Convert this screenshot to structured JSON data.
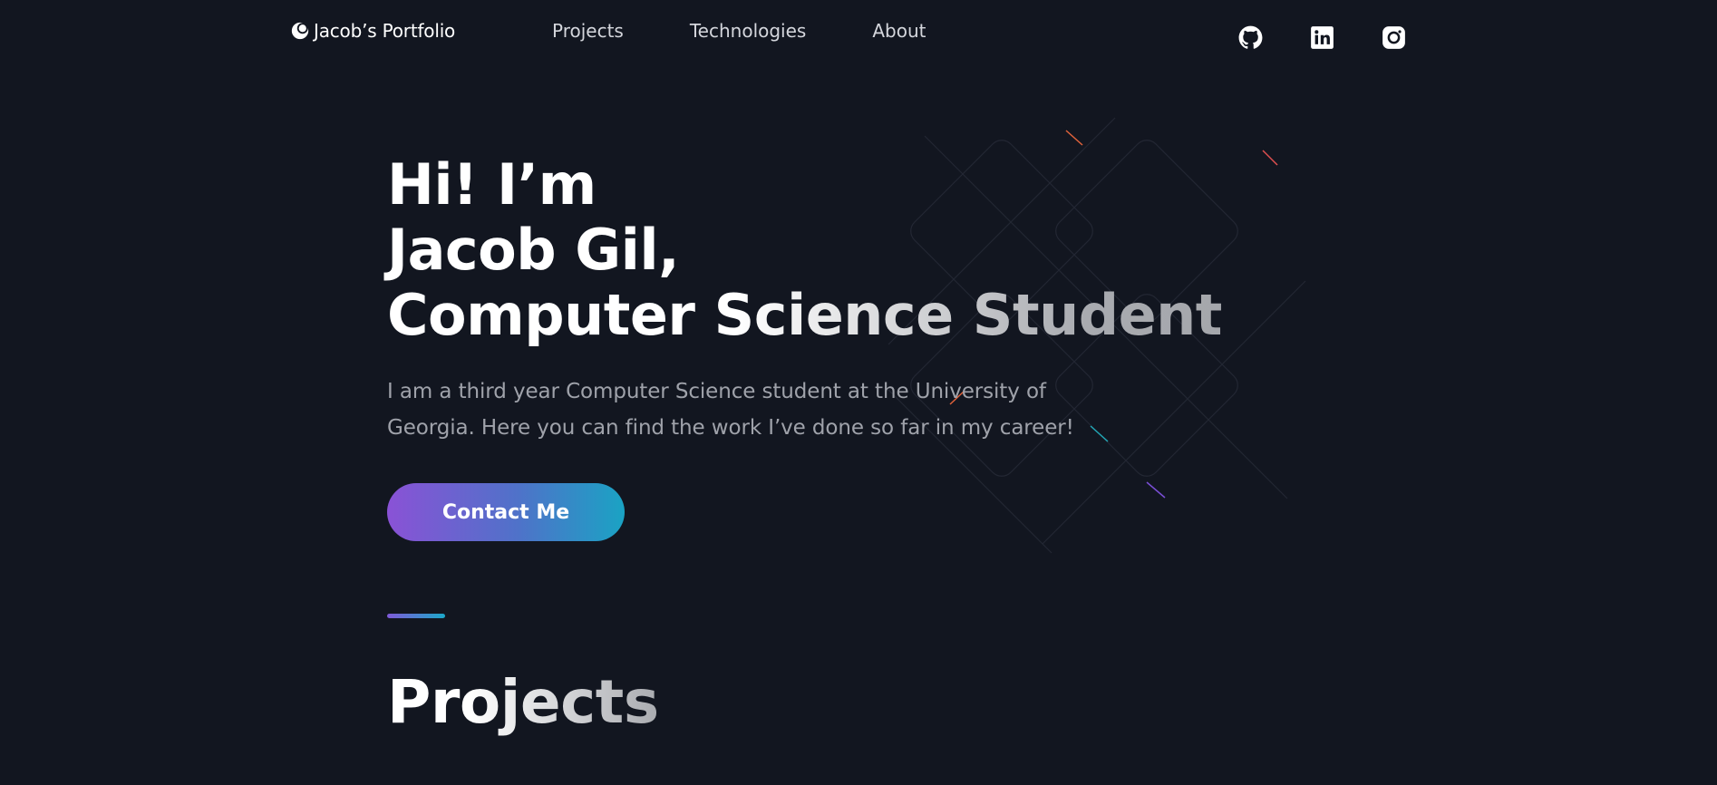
{
  "header": {
    "brand": "Jacob’s Portfolio",
    "nav": [
      {
        "label": "Projects"
      },
      {
        "label": "Technologies"
      },
      {
        "label": "About"
      }
    ],
    "socials": [
      {
        "icon": "github-icon"
      },
      {
        "icon": "linkedin-icon"
      },
      {
        "icon": "instagram-icon"
      }
    ]
  },
  "hero": {
    "line1": "Hi! I’m",
    "line2": "Jacob Gil,",
    "line3": "Computer Science Student",
    "description": "I am a third year Computer Science student at the University of Georgia. Here you can find the work I’ve done so far in my career!",
    "cta_label": "Contact Me"
  },
  "projects": {
    "title": "Projects"
  },
  "colors": {
    "background": "#121620",
    "gradient_start": "#8a52d6",
    "gradient_end": "#1aa3c4",
    "body_text": "#9fa2aa"
  }
}
